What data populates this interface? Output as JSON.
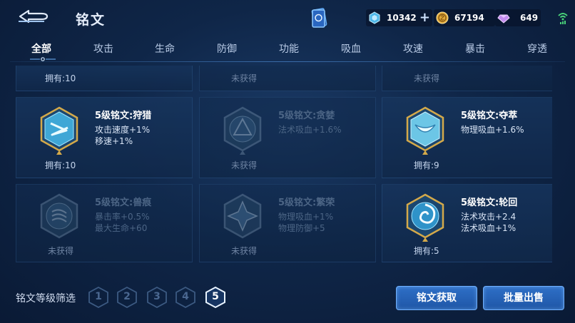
{
  "header": {
    "title": "铭文"
  },
  "currency": {
    "ticket": {
      "value": "10342",
      "icon": "ticket-icon"
    },
    "gold": {
      "value": "67194",
      "icon": "gold-coin-icon"
    },
    "gem": {
      "value": "649",
      "icon": "gem-icon"
    }
  },
  "tabs": [
    {
      "label": "全部",
      "active": true
    },
    {
      "label": "攻击"
    },
    {
      "label": "生命"
    },
    {
      "label": "防御"
    },
    {
      "label": "功能"
    },
    {
      "label": "吸血"
    },
    {
      "label": "攻速"
    },
    {
      "label": "暴击"
    },
    {
      "label": "穿透"
    }
  ],
  "runes": {
    "top": [
      {
        "own": "拥有:10"
      },
      {
        "own": "未获得"
      },
      {
        "own": "未获得"
      }
    ],
    "row1": [
      {
        "name": "5级铭文:狩猎",
        "attrs": [
          "攻击速度+1%",
          "移速+1%"
        ],
        "own": "拥有:10",
        "owned": true
      },
      {
        "name": "5级铭文:贪婪",
        "attrs": [
          "法术吸血+1.6%"
        ],
        "own": "未获得",
        "owned": false
      },
      {
        "name": "5级铭文:夺萃",
        "attrs": [
          "物理吸血+1.6%"
        ],
        "own": "拥有:9",
        "owned": true
      }
    ],
    "row2": [
      {
        "name": "5级铭文:兽痕",
        "attrs": [
          "暴击率+0.5%",
          "最大生命+60"
        ],
        "own": "未获得",
        "owned": false
      },
      {
        "name": "5级铭文:繁荣",
        "attrs": [
          "物理吸血+1%",
          "物理防御+5"
        ],
        "own": "未获得",
        "owned": false
      },
      {
        "name": "5级铭文:轮回",
        "attrs": [
          "法术攻击+2.4",
          "法术吸血+1%"
        ],
        "own": "拥有:5",
        "owned": true
      }
    ]
  },
  "filter": {
    "label": "铭文等级筛选",
    "levels": [
      "1",
      "2",
      "3",
      "4",
      "5"
    ],
    "selected": "5"
  },
  "buttons": {
    "obtain": "铭文获取",
    "sell": "批量出售"
  },
  "colors": {
    "accent": "#2e6fc7",
    "bg": "#0f2648"
  }
}
